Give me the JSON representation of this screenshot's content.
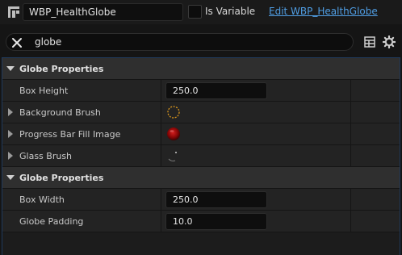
{
  "header": {
    "widget_name": "WBP_HealthGlobe",
    "is_variable_label": "Is Variable",
    "is_variable_checked": false,
    "edit_link": "Edit WBP_HealthGlobe",
    "link_color": "#4f9de3"
  },
  "search": {
    "value": "globe",
    "clear_icon": "close-icon"
  },
  "toolbar_icons": [
    "table-view-icon",
    "gear-icon"
  ],
  "categories": [
    {
      "title": "Globe Properties",
      "rows": [
        {
          "label": "Box Height",
          "value": "250.0"
        },
        {
          "label": "Background Brush",
          "thumbnail": "dashed-ring"
        },
        {
          "label": "Progress Bar Fill Image",
          "thumbnail": "red-orb"
        },
        {
          "label": "Glass Brush",
          "thumbnail": "glass-arc"
        }
      ]
    },
    {
      "title": "Globe Properties",
      "rows": [
        {
          "label": "Box Width",
          "value": "250.0"
        },
        {
          "label": "Globe Padding",
          "value": "10.0"
        }
      ]
    }
  ]
}
